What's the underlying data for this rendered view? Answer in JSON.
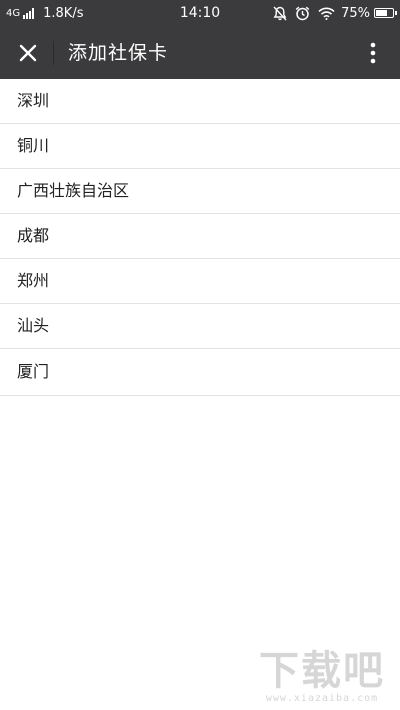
{
  "status_bar": {
    "network": "4G",
    "speed": "1.8K/s",
    "time": "14:10",
    "battery_percent": "75%",
    "battery_level": 0.75,
    "icons": [
      "signal-icon",
      "mute-bell-icon",
      "alarm-icon",
      "wifi-icon",
      "battery-icon"
    ]
  },
  "header": {
    "title": "添加社保卡",
    "close_icon": "close-icon",
    "more_icon": "more-vertical-icon"
  },
  "cities": [
    {
      "label": "深圳"
    },
    {
      "label": "铜川"
    },
    {
      "label": "广西壮族自治区"
    },
    {
      "label": "成都"
    },
    {
      "label": "郑州"
    },
    {
      "label": "汕头"
    },
    {
      "label": "厦门"
    }
  ],
  "watermark": {
    "text": "下载吧",
    "url": "www.xiazaiba.com"
  },
  "colors": {
    "header_bg": "#3b3b3d",
    "list_bg": "#ffffff",
    "divider": "#e3e3e3"
  }
}
